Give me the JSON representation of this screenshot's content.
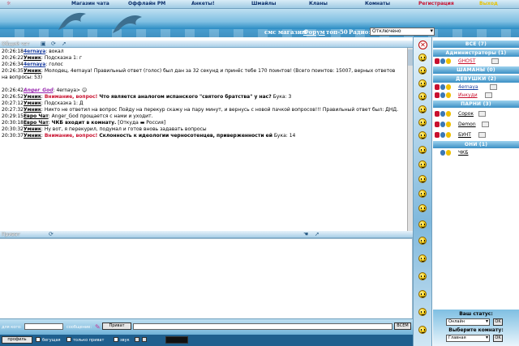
{
  "nav": {
    "items": [
      {
        "label": "Магазин чата"
      },
      {
        "label": "Оффлайн РМ"
      },
      {
        "label": "Анкеты!"
      },
      {
        "label": "Шмайлы"
      },
      {
        "label": "Кланы"
      },
      {
        "label": "Комнаты"
      },
      {
        "label": "Регистрация",
        "color": "#c8102e"
      },
      {
        "label": "Выход",
        "color": "#e8c200"
      }
    ]
  },
  "banner": {
    "links": [
      "смс магазин",
      "Форум",
      "топ-50",
      "Радио:"
    ],
    "radio_value": "Отключено"
  },
  "chat": {
    "header_label": "Общий чат",
    "messages": [
      {
        "time": "20:26:18",
        "nick": "4ernaya",
        "nick_style": "blue",
        "text": ": вокал"
      },
      {
        "time": "20:26:22",
        "nick": "Умник",
        "text": ": Подсказка 1: г"
      },
      {
        "time": "20:26:34",
        "nick": "4ernaya",
        "nick_style": "blue",
        "text": ": голос"
      },
      {
        "time": "20:26:35",
        "nick": "Умник",
        "text": ": Молодец, 4ernaya! Правильный ответ (голос) был дан за 32 секунд и принёс тебе 170 поинтов! (Всего поинтов: 15007, верных ответов"
      },
      {
        "time": "",
        "nick": "",
        "text": "на вопросы: 53)"
      },
      {
        "time": "",
        "nick": "",
        "text": ""
      },
      {
        "time": "20:26:42",
        "nick": "Anger_God",
        "nick_style": "purple",
        "text": ": 4ernaya> ☺"
      },
      {
        "time": "20:26:52",
        "nick": "Умник",
        "text": ": ",
        "alert": "Внимание, вопрос!",
        "bold": " Что является аналогом испанского \"святого братства\" у нас?",
        "tail": " Бука: 3"
      },
      {
        "time": "20:27:12",
        "nick": "Умник",
        "text": ": Подсказка 1: Д"
      },
      {
        "time": "20:27:32",
        "nick": "Умник",
        "text": ": Никто не ответил на вопрос Пойду на перекур скажу на пару минут, и вернусь с новой пачкой вопросов!!! Правильный ответ был: ДНД."
      },
      {
        "time": "20:29:15",
        "nick": "Евро Чат",
        "text": ": Anger_God прощается с нами и уходит."
      },
      {
        "time": "20:30:18",
        "nick": "Евро Чат",
        "text": ": ",
        "bold": "ЧКБ входит в комнату.",
        "tail": " [Откуда ▬ Россия]"
      },
      {
        "time": "20:30:32",
        "nick": "Умник",
        "text": ": Ну вот, я перекурил, подумал и готов вновь задавать вопросы"
      },
      {
        "time": "20:30:37",
        "nick": "Умник",
        "text": ": ",
        "alert": "Внимание, вопрос!",
        "bold": " Склонность к идеологии черносотенцев, приверженности ей",
        "tail": " Бука: 14"
      }
    ]
  },
  "private": {
    "header_label": "Приват"
  },
  "input": {
    "to_label": "для кого:",
    "msg_label": "сообщение:",
    "private_btn": "Приват",
    "send_btn": "ВСЕМ"
  },
  "bottom": {
    "profile_btn": "профиль",
    "opt1": "бегущая",
    "opt2": "только приват",
    "opt3": "звук"
  },
  "users": {
    "groups": [
      {
        "label": "ВСЕ (7)"
      },
      {
        "label": "Администраторы (1)"
      },
      {
        "label": "ШАМАНЫ (0)"
      },
      {
        "label": "ДЕВУШКИ (2)"
      },
      {
        "label": "ПАРНИ (3)"
      },
      {
        "label": "ОНИ (1)"
      }
    ],
    "list": [
      {
        "name": "GHOST",
        "color": "#c8102e"
      },
      {
        "name": "4ernaya",
        "color": "#1a3ea0"
      },
      {
        "name": "Инкуди",
        "color": "#c8102e"
      },
      {
        "name": "Сорок",
        "color": "#000"
      },
      {
        "name": "Demon",
        "color": "#000"
      },
      {
        "name": "БУНТ",
        "color": "#000"
      },
      {
        "name": "ЧКБ",
        "color": "#000"
      }
    ]
  },
  "panel": {
    "status_label": "Ваш статус:",
    "status_value": "Онлайн",
    "room_label": "Выберите комнату:",
    "room_value": "Главная",
    "ok_label": "OK"
  },
  "colors": {
    "accent": "#2f8fc5",
    "alert": "#c8102e"
  }
}
